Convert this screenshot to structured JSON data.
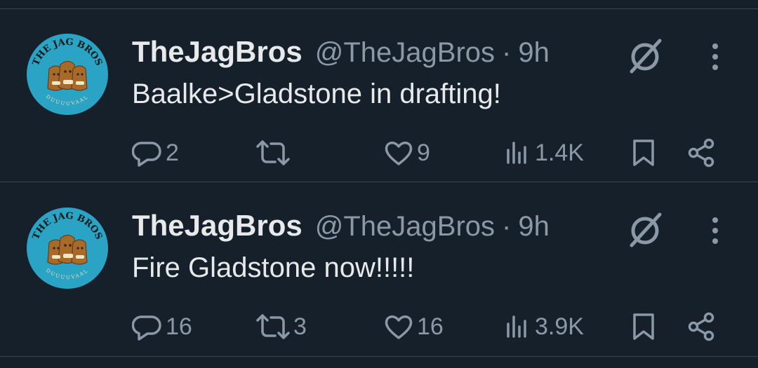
{
  "colors": {
    "background": "#15202b",
    "text": "#e7e9ea",
    "muted": "#8b98a5",
    "divider": "#38444d",
    "avatar_bg": "#2aa3c4"
  },
  "tweets": [
    {
      "avatar_text": "THE JAG BROS",
      "avatar_sub": "DUUUUVAAL",
      "name": "TheJagBros",
      "handle": "@TheJagBros",
      "separator": "·",
      "time": "9h",
      "text": "Baalke>Gladstone in drafting!",
      "replies": "2",
      "reposts": "",
      "likes": "9",
      "views": "1.4K",
      "icons": [
        "grok-icon",
        "more-icon",
        "reply-icon",
        "repost-icon",
        "like-icon",
        "views-icon",
        "bookmark-icon",
        "share-icon"
      ]
    },
    {
      "avatar_text": "THE JAG BROS",
      "avatar_sub": "DUUUUVAAL",
      "name": "TheJagBros",
      "handle": "@TheJagBros",
      "separator": "·",
      "time": "9h",
      "text": "Fire Gladstone now!!!!!",
      "replies": "16",
      "reposts": "3",
      "likes": "16",
      "views": "3.9K",
      "icons": [
        "grok-icon",
        "more-icon",
        "reply-icon",
        "repost-icon",
        "like-icon",
        "views-icon",
        "bookmark-icon",
        "share-icon"
      ]
    }
  ]
}
